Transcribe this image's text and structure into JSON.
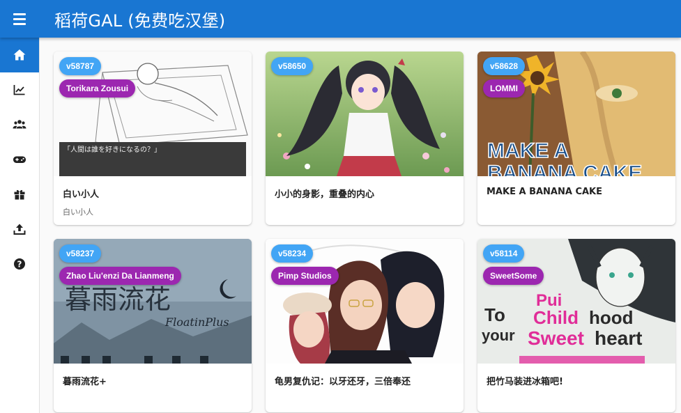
{
  "app": {
    "title": "稻荷GAL (免费吃汉堡)"
  },
  "sidebar": {
    "items": [
      {
        "icon": "home-icon",
        "active": true
      },
      {
        "icon": "chart-line-icon",
        "active": false
      },
      {
        "icon": "users-icon",
        "active": false
      },
      {
        "icon": "gamepad-icon",
        "active": false
      },
      {
        "icon": "gift-icon",
        "active": false
      },
      {
        "icon": "upload-icon",
        "active": false
      },
      {
        "icon": "help-circle-icon",
        "active": false
      }
    ]
  },
  "colors": {
    "primary": "#1976d2",
    "id_badge": "#42a5f5",
    "studio_badge": "#9c27b0"
  },
  "cards": [
    {
      "id": "v58787",
      "studio": "Torikara Zousui",
      "title": "白い小人",
      "subtitle": "白い小人",
      "thumb_caption": "「人間は誰を好きになるの？」"
    },
    {
      "id": "v58650",
      "studio": "",
      "title": "小小的身影，重叠的内心",
      "subtitle": ""
    },
    {
      "id": "v58628",
      "studio": "LOMMI",
      "title": "MAKE A BANANA CAKE",
      "subtitle": "",
      "thumb_caption": "MAKE A BANANA CAKE"
    },
    {
      "id": "v58237",
      "studio": "Zhao Liu'enzi Da Lianmeng",
      "title": "暮雨流花+",
      "subtitle": "",
      "thumb_caption": "暮雨流花",
      "thumb_caption2": "FloatinPlus"
    },
    {
      "id": "v58234",
      "studio": "Pimp Studios",
      "title": "龟男复仇记：以牙还牙，三倍奉还",
      "subtitle": ""
    },
    {
      "id": "v58114",
      "studio": "SweetSome",
      "title": "把竹马装进冰箱吧!",
      "subtitle": "",
      "thumb_caption": "To your Childhood Sweetheart"
    }
  ]
}
